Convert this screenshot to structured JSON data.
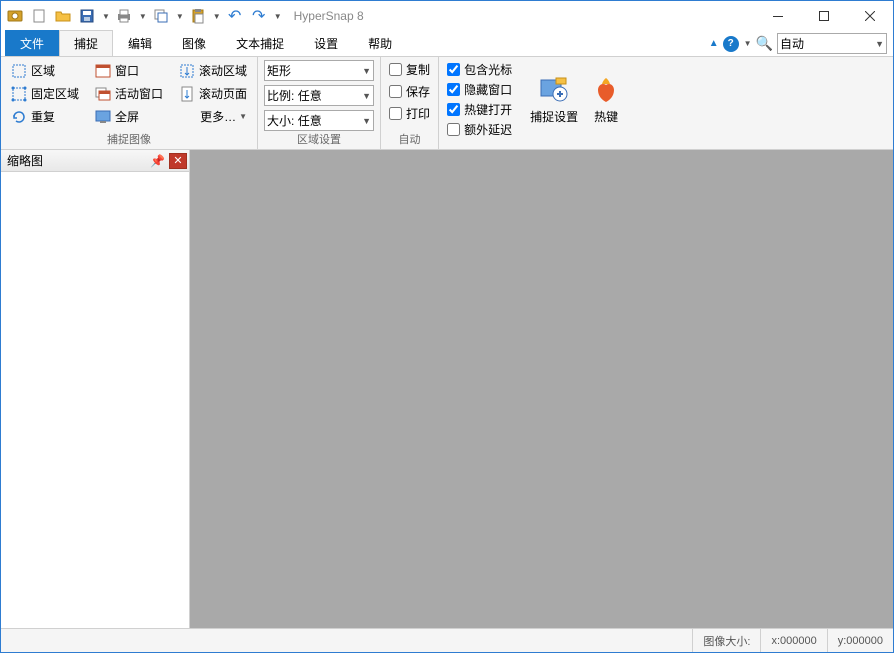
{
  "app": {
    "title": "HyperSnap 8"
  },
  "tabs": {
    "file": "文件",
    "items": [
      "捕捉",
      "编辑",
      "图像",
      "文本捕捉",
      "设置",
      "帮助"
    ],
    "active_index": 0
  },
  "zoom": {
    "value": "自动"
  },
  "ribbon": {
    "group_capture": {
      "label": "捕捉图像",
      "col1": [
        "区域",
        "固定区域",
        "重复"
      ],
      "col2": [
        "窗口",
        "活动窗口",
        "全屏"
      ],
      "col3": [
        "滚动区域",
        "滚动页面"
      ],
      "more": "更多…"
    },
    "group_region": {
      "label": "区域设置",
      "shape": "矩形",
      "ratio": "比例: 任意",
      "size": "大小: 任意"
    },
    "group_auto": {
      "label": "自动",
      "items": [
        "复制",
        "保存",
        "打印"
      ]
    },
    "group_opts": {
      "items": [
        "包含光标",
        "隐藏窗口",
        "热键打开",
        "额外延迟"
      ],
      "checked": [
        true,
        true,
        true,
        false
      ]
    },
    "group_big": {
      "btn1": "捕捉设置",
      "btn2": "热键"
    }
  },
  "thumb_panel": {
    "title": "缩略图"
  },
  "status": {
    "label": "图像大小:",
    "x": "x:000000",
    "y": "y:000000"
  }
}
